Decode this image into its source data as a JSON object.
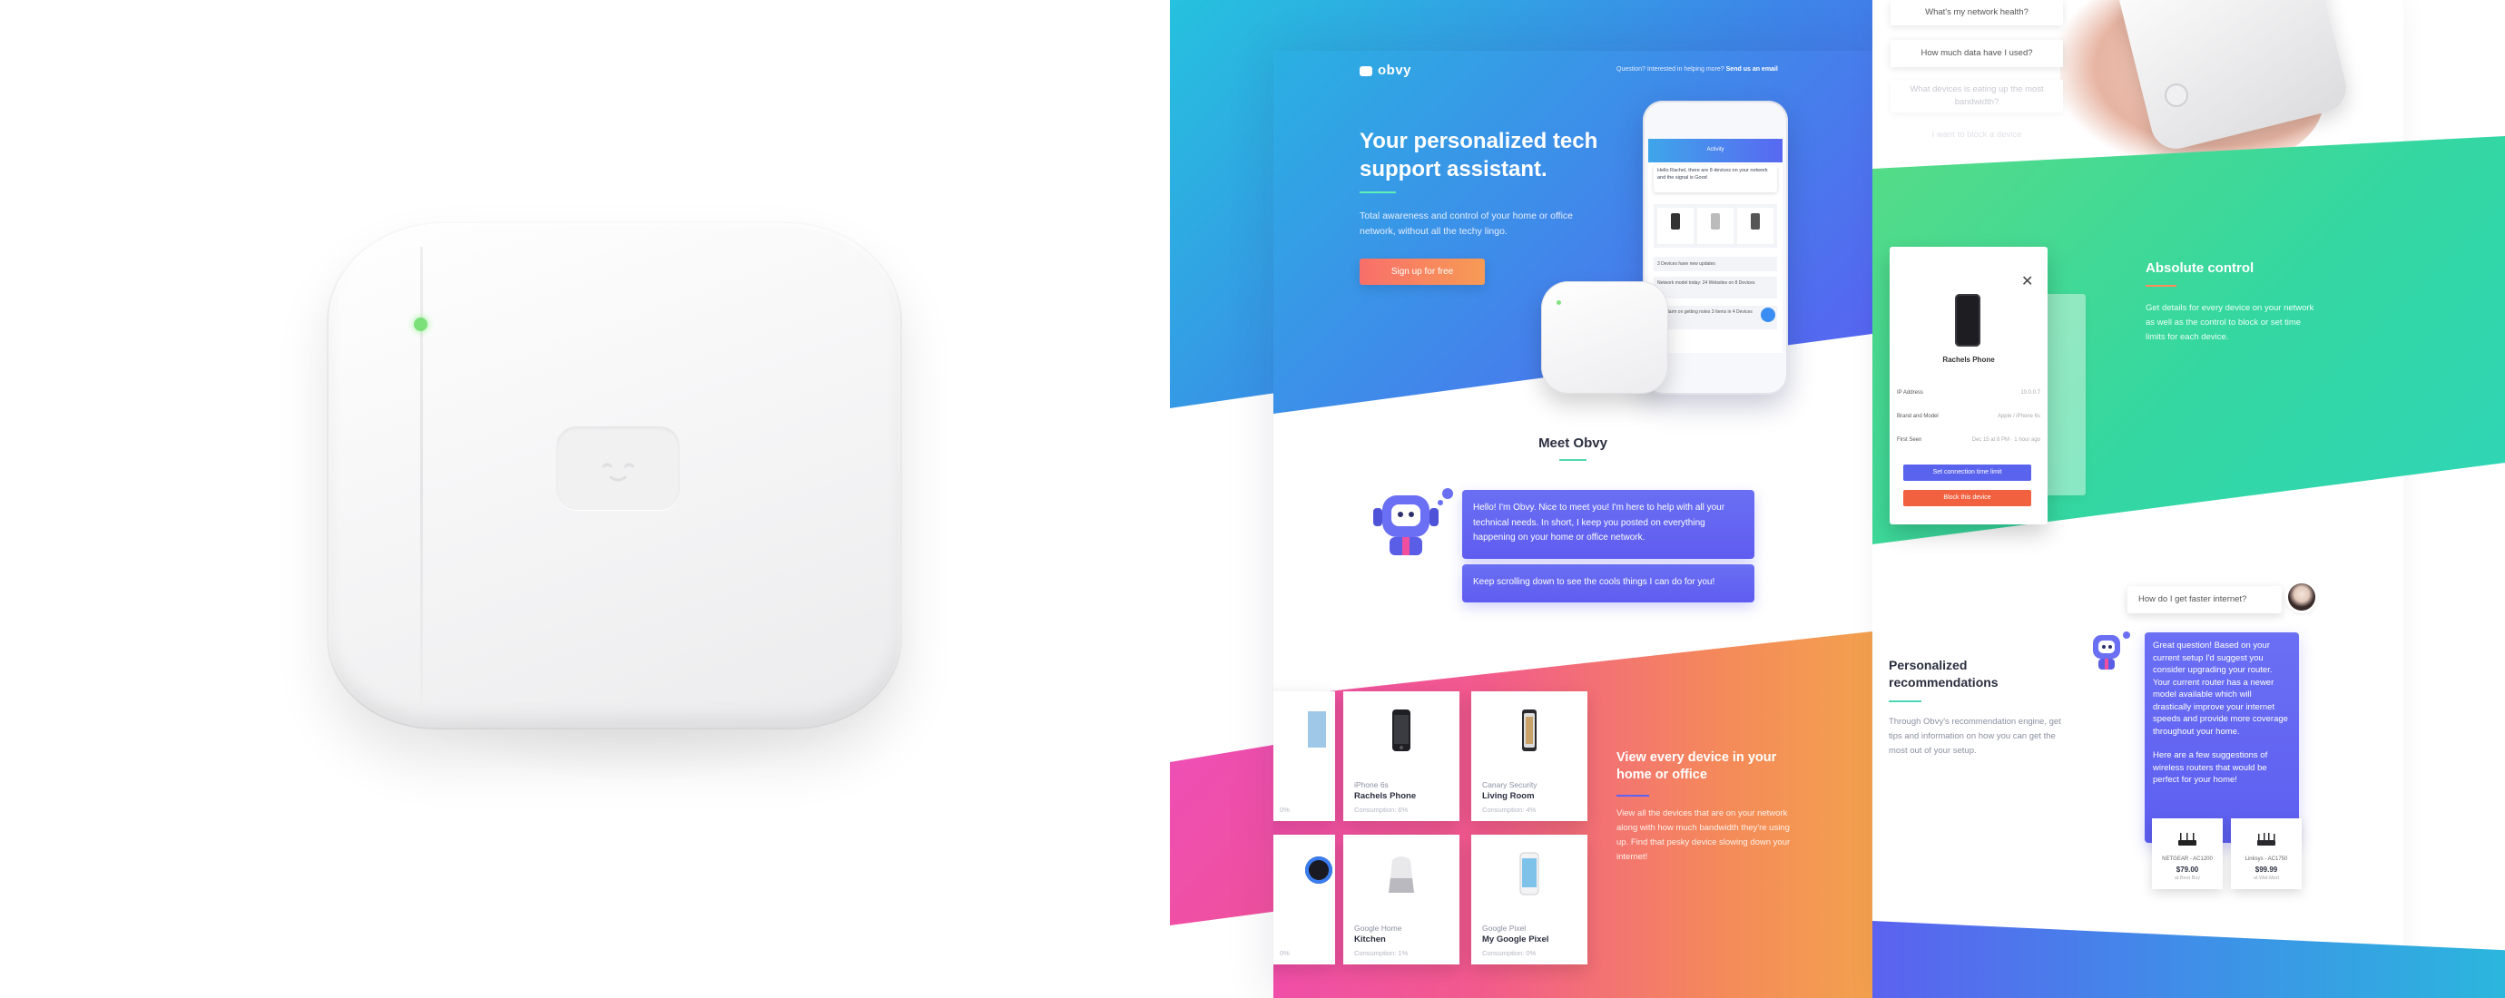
{
  "landing": {
    "logo": "obvy",
    "nav_question": "Question? Interested in helping more?",
    "nav_link": "Send us an email",
    "hero_title": "Your personalized tech support assistant.",
    "hero_subtitle": "Total awareness and control of your home or office network, without all the techy lingo.",
    "signup_button": "Sign up for free",
    "phone": {
      "title": "Activity",
      "greeting": "Hello Rachel, there are 8 devices on your network and the signal is Good",
      "row1": "3 Devices have new updates",
      "row2": "Network model today: 24 Websites on 8 Devices",
      "row3": "Tell alarm on getting notes 3 Items in 4 Devices"
    },
    "meet_title": "Meet Obvy",
    "bubble1": "Hello! I'm Obvy. Nice to meet you! I'm here to help with all your technical needs. In short, I keep you posted on everything happening on your home or office network.",
    "bubble2": "Keep scrolling down to see the cools things I can do for you!",
    "view_title": "View every device in your home or office",
    "view_subtitle": "View all the devices that are on your network along with how much bandwidth they're using up. Find that pesky device slowing down your internet!",
    "devices": [
      {
        "category": "iPhone 6s",
        "name": "Rachels Phone",
        "consumption": "Consumption: 6%"
      },
      {
        "category": "Canary Security",
        "name": "Living Room",
        "consumption": "Consumption: 4%"
      },
      {
        "category": "Google Home",
        "name": "Kitchen",
        "consumption": "Consumption: 1%"
      },
      {
        "category": "Google Pixel",
        "name": "My Google Pixel",
        "consumption": "Consumption: 0%"
      }
    ],
    "partial_cards": [
      "0%",
      "0%"
    ]
  },
  "right": {
    "questions": [
      "What's my network health?",
      "How much data have I used?",
      "What devices is eating up the most bandwidth?",
      "I want to block a device"
    ],
    "modal": {
      "device_name": "Rachels Phone",
      "rows": [
        {
          "label": "IP Address",
          "value": "10.0.0.7"
        },
        {
          "label": "Brand and Model",
          "value": "Apple / iPhone 6s"
        },
        {
          "label": "First Seen",
          "value": "Dec 15 at 8 PM · 1 hour ago"
        }
      ],
      "limit_button": "Set connection time limit",
      "block_button": "Block this device"
    },
    "absolute_title": "Absolute control",
    "absolute_subtitle": "Get details for every device on your network as well as the control to block or set time limits for each device.",
    "personalized_title": "Personalized recommendations",
    "personalized_subtitle": "Through Obvy's recommendation engine, get tips and information on how you can get the most out of your setup.",
    "user_question": "How do I get faster internet?",
    "bot_answer_1": "Great question! Based on your current setup I'd suggest you consider upgrading your router. Your current router has a newer model available which will drastically improve your internet speeds and provide more coverage throughout your home.",
    "bot_answer_2": "Here are a few suggestions of wireless routers that would be perfect for your home!",
    "routers": [
      {
        "name": "NETGEAR - AC1200",
        "price": "$79.00",
        "store": "at Best Buy"
      },
      {
        "name": "Linksys - AC1750",
        "price": "$99.99",
        "store": "at Wal-Mart"
      }
    ]
  },
  "colors": {
    "hero_gradient_start": "#2ab0e2",
    "hero_gradient_end": "#5a5ef2",
    "signup": "#f86f6a",
    "bubble": "#6a6ff3",
    "green": "#34d7a1",
    "pink": "#f04ea8",
    "orange": "#f3a14e",
    "block": "#f2613f"
  }
}
